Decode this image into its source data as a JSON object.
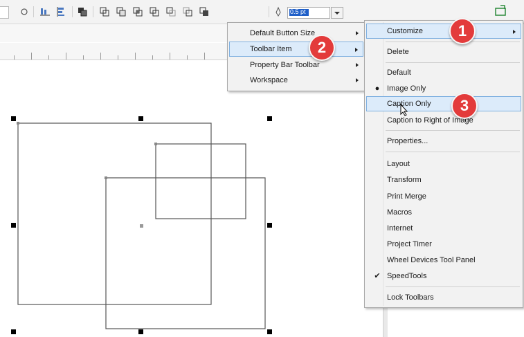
{
  "toolbar": {
    "outline_width": "0.5 pt",
    "icons": [
      "snap-icon",
      "align-icon",
      "distribute-icon",
      "arrange-icon",
      "weld-icon",
      "trim-icon",
      "intersect-icon",
      "simplify-icon",
      "front-minus-back-icon",
      "back-minus-front-icon",
      "create-boundary-icon",
      "pen-icon",
      "outline-width-field",
      "color-icon",
      "undo-icon",
      "redo-icon",
      "options-icon"
    ]
  },
  "submenu_primary": {
    "items": [
      {
        "label": "Default Button Size",
        "has_submenu": true
      },
      {
        "label": "Toolbar Item",
        "has_submenu": true,
        "highlighted": true
      },
      {
        "label": "Property Bar Toolbar",
        "has_submenu": true
      },
      {
        "label": "Workspace",
        "has_submenu": true
      }
    ]
  },
  "context_menu": {
    "items": [
      {
        "label": "Customize",
        "has_submenu": true,
        "highlighted": true
      },
      {
        "label": "Delete"
      },
      {
        "label": "Default"
      },
      {
        "label": "Image Only",
        "mark": "bullet"
      },
      {
        "label": "Caption Only",
        "highlighted": true
      },
      {
        "label": "Caption to Right of Image"
      },
      {
        "label": "Properties..."
      },
      {
        "label": "Layout"
      },
      {
        "label": "Transform"
      },
      {
        "label": "Print Merge"
      },
      {
        "label": "Macros"
      },
      {
        "label": "Internet"
      },
      {
        "label": "Project Timer"
      },
      {
        "label": "Wheel Devices Tool Panel"
      },
      {
        "label": "SpeedTools",
        "mark": "check"
      },
      {
        "label": "Lock Toolbars"
      }
    ]
  },
  "callouts": [
    "1",
    "2",
    "3"
  ],
  "colors": {
    "callout": "#e33b3b",
    "highlight": "#dcebfa",
    "highlight_border": "#7fb0e0",
    "selection": "#1f5fc8"
  }
}
